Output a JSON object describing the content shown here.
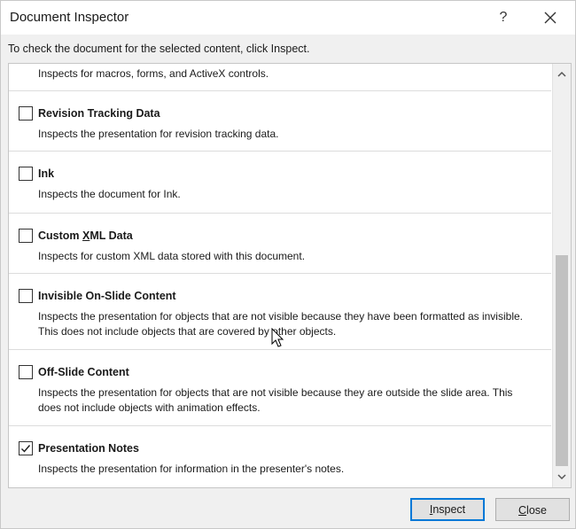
{
  "window": {
    "title": "Document Inspector",
    "help_label": "?"
  },
  "instruction": "To check the document for the selected content, click Inspect.",
  "items": [
    {
      "title": "",
      "description": "Inspects for macros, forms, and ActiveX controls.",
      "checked": false,
      "partial": true
    },
    {
      "title": "Revision Tracking Data",
      "description": "Inspects the presentation for revision tracking data.",
      "checked": false
    },
    {
      "title": "Ink",
      "description": "Inspects the document for Ink.",
      "checked": false
    },
    {
      "title_parts": [
        "Custom ",
        "X",
        "ML Data"
      ],
      "title": "Custom XML Data",
      "description": "Inspects for custom XML data stored with this document.",
      "checked": false
    },
    {
      "title": "Invisible On-Slide Content",
      "description": "Inspects the presentation for objects that are not visible because they have been formatted as invisible. This does not include objects that are covered by other objects.",
      "checked": false
    },
    {
      "title": "Off-Slide Content",
      "description": "Inspects the presentation for objects that are not visible because they are outside the slide area. This does not include objects with animation effects.",
      "checked": false
    },
    {
      "title": "Presentation Notes",
      "description": "Inspects the presentation for information in the presenter's notes.",
      "checked": true,
      "highlighted": true
    }
  ],
  "buttons": {
    "inspect": {
      "accel": "I",
      "rest": "nspect"
    },
    "close": {
      "accel": "C",
      "rest": "lose"
    }
  },
  "colors": {
    "highlight_border": "#e4575c",
    "default_button_border": "#0078d7"
  }
}
